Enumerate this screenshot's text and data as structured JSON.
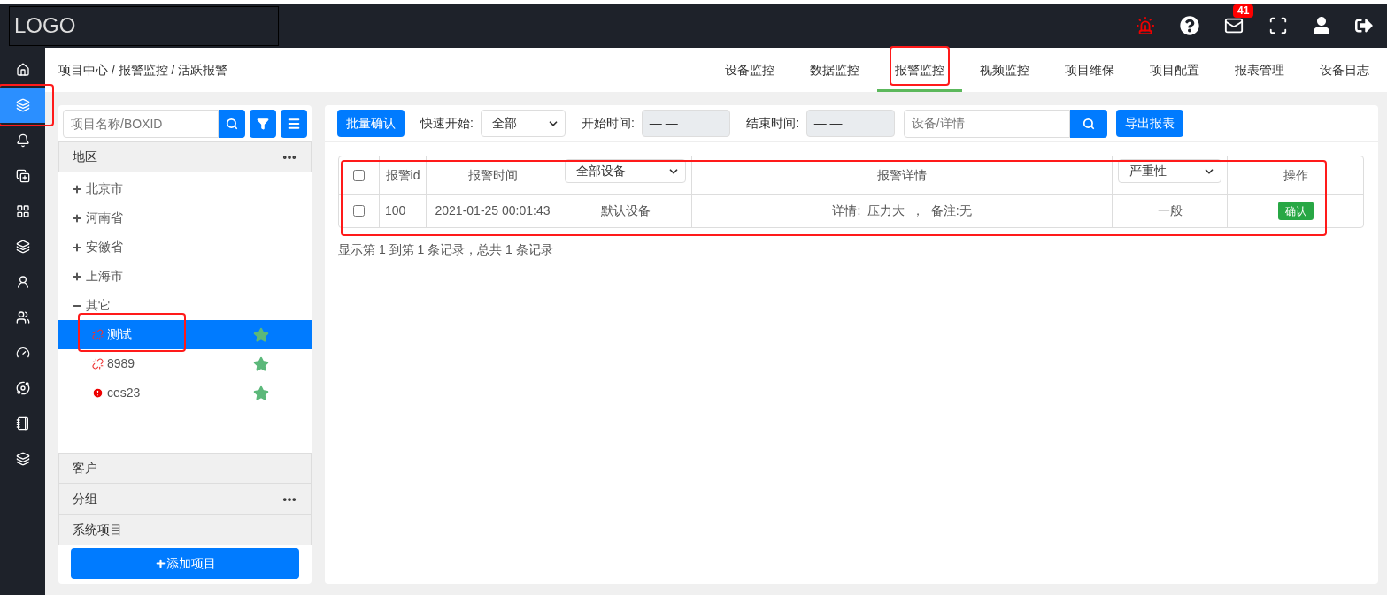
{
  "logo": "LOGO",
  "rail": [
    {
      "selected": false,
      "annotated": false
    },
    {
      "selected": true,
      "annotated": true
    },
    {
      "selected": false,
      "annotated": false
    },
    {
      "selected": false,
      "annotated": false
    },
    {
      "selected": false,
      "annotated": false
    },
    {
      "selected": false,
      "annotated": false
    },
    {
      "selected": false,
      "annotated": false
    },
    {
      "selected": false,
      "annotated": false
    },
    {
      "selected": false,
      "annotated": false
    },
    {
      "selected": false,
      "annotated": false
    },
    {
      "selected": false,
      "annotated": false
    },
    {
      "selected": false,
      "annotated": false
    }
  ],
  "topbar": {
    "mail_badge": "41"
  },
  "breadcrumb": "项目中心 / 报警监控 / 活跃报警",
  "tabs": [
    {
      "label": "设备监控",
      "selected": false,
      "annotated": false
    },
    {
      "label": "数据监控",
      "selected": false,
      "annotated": false
    },
    {
      "label": "报警监控",
      "selected": true,
      "annotated": true
    },
    {
      "label": "视频监控",
      "selected": false,
      "annotated": false
    },
    {
      "label": "项目维保",
      "selected": false,
      "annotated": false
    },
    {
      "label": "项目配置",
      "selected": false,
      "annotated": false
    },
    {
      "label": "报表管理",
      "selected": false,
      "annotated": false
    },
    {
      "label": "设备日志",
      "selected": false,
      "annotated": false
    }
  ],
  "sidebar": {
    "search": {
      "placeholder": "项目名称/BOXID"
    },
    "sections": [
      {
        "title": "地区",
        "has_menu": true,
        "tree": [
          {
            "label": "北京市",
            "expanded": false
          },
          {
            "label": "河南省",
            "expanded": false
          },
          {
            "label": "安徽省",
            "expanded": false
          },
          {
            "label": "上海市",
            "expanded": false
          },
          {
            "label": "其它",
            "expanded": true,
            "children": [
              {
                "label": "测试",
                "kind": "disconnected",
                "selected": true,
                "annotated": true,
                "starred": true
              },
              {
                "label": "8989",
                "kind": "disconnected",
                "selected": false,
                "annotated": false,
                "starred": true
              },
              {
                "label": "ces23",
                "kind": "alarm",
                "selected": false,
                "annotated": false,
                "starred": true
              }
            ]
          }
        ]
      },
      {
        "title": "客户",
        "has_menu": false
      },
      {
        "title": "分组",
        "has_menu": true
      },
      {
        "title": "系统项目",
        "has_menu": false
      }
    ],
    "add_button": "添加项目"
  },
  "toolbar": {
    "batch_button": "批量确认",
    "quick_label": "快速开始:",
    "quick_value": "全部",
    "start_label": "开始时间:",
    "start_value": "— —",
    "end_label": "结束时间:",
    "end_value": "— —",
    "search_placeholder": "设备/详情",
    "export_button": "导出报表"
  },
  "table": {
    "annotated": true,
    "columns": [
      {
        "kind": "checkbox",
        "checked": false
      },
      {
        "kind": "text",
        "label": "报警id"
      },
      {
        "kind": "text",
        "label": "报警时间"
      },
      {
        "kind": "select",
        "label": "全部设备"
      },
      {
        "kind": "text",
        "label": "报警详情"
      },
      {
        "kind": "select",
        "label": "严重性"
      },
      {
        "kind": "text",
        "label": "操作"
      }
    ],
    "rows": [
      {
        "checked": false,
        "id": "100",
        "time": "2021-01-25 00:01:43",
        "device": "默认设备",
        "detail": "详情:  压力大  ，  备注:无",
        "severity": "一般",
        "action": "确认"
      }
    ]
  },
  "pagination_info": "显示第 1 到第 1 条记录，总共 1 条记录"
}
